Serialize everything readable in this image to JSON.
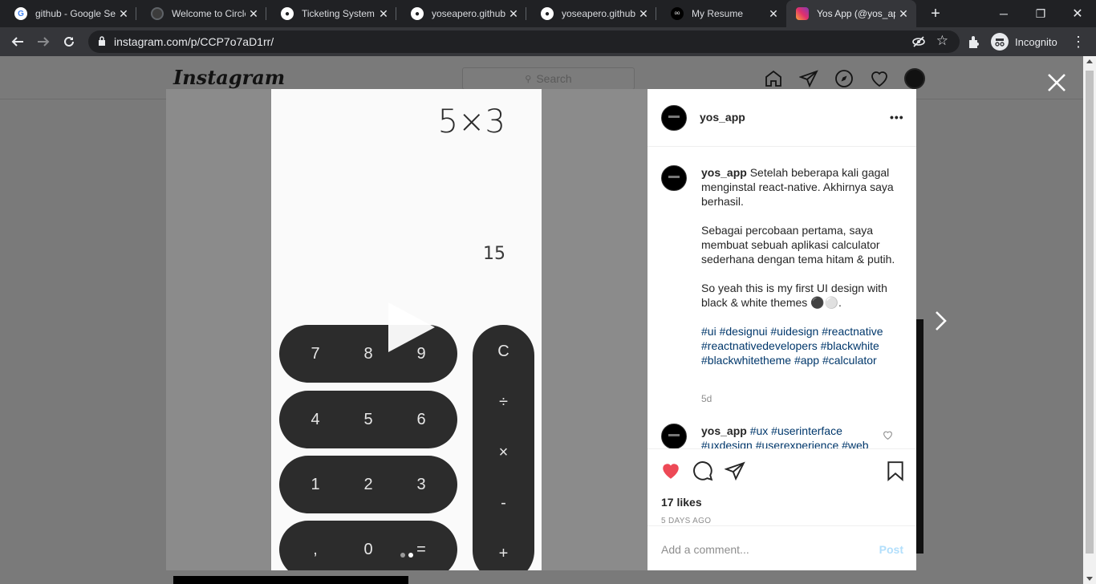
{
  "browser": {
    "tabs": [
      {
        "title": "github - Google Se",
        "icon": "google-icon",
        "color": "#ffffff"
      },
      {
        "title": "Welcome to Circle",
        "icon": "circleci-icon",
        "color": "#5f6368"
      },
      {
        "title": "Ticketing System -",
        "icon": "github-icon",
        "color": "#ffffff"
      },
      {
        "title": "yoseapero.github.",
        "icon": "github-icon",
        "color": "#ffffff"
      },
      {
        "title": "yoseapero.github.",
        "icon": "github-icon",
        "color": "#ffffff"
      },
      {
        "title": "My Resume",
        "icon": "resume-icon",
        "color": "#000000"
      },
      {
        "title": "Yos App (@yos_ap",
        "icon": "instagram-icon",
        "color": "#e1306c"
      }
    ],
    "active_tab": 6,
    "url": "instagram.com/p/CCP7o7aD1rr/",
    "profile_label": "Incognito"
  },
  "instagram": {
    "logo": "Instagram",
    "search_placeholder": "Search"
  },
  "post": {
    "username": "yos_app",
    "caption_user": "yos_app",
    "caption_lines": [
      "Setelah beberapa kali gagal menginstal react-native. Akhirnya saya berhasil.",
      "Sebagai percobaan pertama, saya membuat sebuah aplikasi calculator sederhana dengan tema hitam & putih.",
      "So yeah this is my first UI design with black & white themes ⚫⚪."
    ],
    "hashtags": "#ui #designui #uidesign #reactnative #reactnativedevelopers #blackwhite #blackwhitetheme #app #calculator",
    "age": "5d",
    "comment2_user": "yos_app",
    "comment2_text": "#ux #userinterface #uxdesign #userexperience #web",
    "likes": "17 likes",
    "posted": "5 DAYS AGO",
    "comment_placeholder": "Add a comment...",
    "post_label": "Post",
    "like_color": "#ed4956"
  },
  "calculator": {
    "expression": "5×3",
    "result": "15",
    "rows": [
      [
        "7",
        "8",
        "9"
      ],
      [
        "4",
        "5",
        "6"
      ],
      [
        "1",
        "2",
        "3"
      ],
      [
        ",",
        "0",
        "="
      ]
    ],
    "ops": [
      "C",
      "÷",
      "×",
      "-",
      "+"
    ],
    "carousel_index": 2,
    "carousel_count": 2
  }
}
